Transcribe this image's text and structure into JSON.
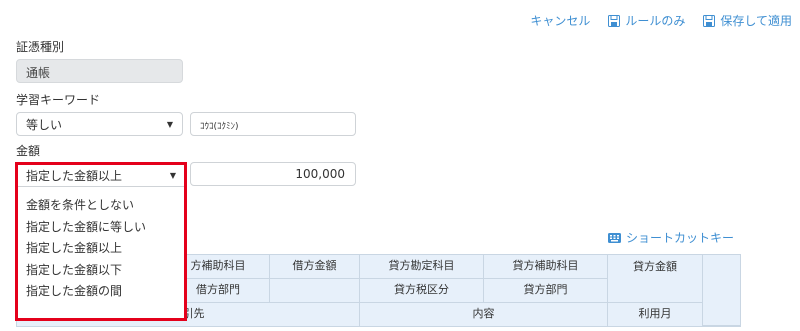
{
  "toolbar": {
    "cancel": "キャンセル",
    "rule_only": "ルールのみ",
    "save_apply": "保存して適用"
  },
  "form": {
    "voucher_type_label": "証憑種別",
    "voucher_type_value": "通帳",
    "keyword_label": "学習キーワード",
    "keyword_condition": "等しい",
    "keyword_value": "ｺｳｺ(ｺｸﾐﾝ)",
    "amount_label": "金額",
    "amount_condition": "指定した金額以上",
    "amount_value": "100,000"
  },
  "dropdown": {
    "options": [
      "金額を条件としない",
      "指定した金額に等しい",
      "指定した金額以上",
      "指定した金額以下",
      "指定した金額の間"
    ]
  },
  "shortcut_label": "ショートカットキー",
  "grid": {
    "row1": [
      "方補助科目",
      "借方金額",
      "貸方勘定科目",
      "貸方補助科目",
      "貸方金額"
    ],
    "row2": [
      "借方部門",
      "貸方税区分",
      "貸方部門"
    ],
    "row3": [
      "取引先",
      "内容",
      "利用月"
    ]
  },
  "colors": {
    "link_blue": "#3f8fd2",
    "highlight_red": "#e4001b",
    "grid_bg": "#e7f0fa"
  }
}
